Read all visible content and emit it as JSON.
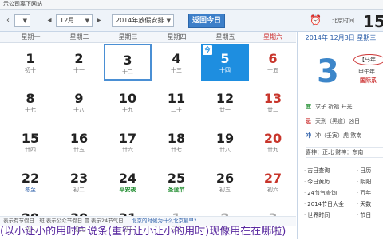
{
  "topbar": {
    "crumb": "示公司离下网站"
  },
  "toolbar": {
    "month": "12月",
    "holiday": "2014年放假安排",
    "today_button": "返回今日",
    "timezone": "北京时间",
    "time": "15:"
  },
  "weekdays": [
    "星期一",
    "星期二",
    "星期三",
    "星期四",
    "星期五",
    "星期六"
  ],
  "weeks": [
    [
      {
        "n": "1",
        "l": "初十"
      },
      {
        "n": "2",
        "l": "十一"
      },
      {
        "n": "3",
        "l": "十二",
        "state": "selected"
      },
      {
        "n": "4",
        "l": "十三"
      },
      {
        "n": "5",
        "l": "十四",
        "state": "today"
      },
      {
        "n": "6",
        "l": "十五",
        "wk": true
      }
    ],
    [
      {
        "n": "8",
        "l": "十七"
      },
      {
        "n": "9",
        "l": "十八"
      },
      {
        "n": "10",
        "l": "十九"
      },
      {
        "n": "11",
        "l": "二十"
      },
      {
        "n": "12",
        "l": "廿一"
      },
      {
        "n": "13",
        "l": "廿二",
        "wk": true
      }
    ],
    [
      {
        "n": "15",
        "l": "廿四"
      },
      {
        "n": "16",
        "l": "廿五"
      },
      {
        "n": "17",
        "l": "廿六"
      },
      {
        "n": "18",
        "l": "廿七"
      },
      {
        "n": "19",
        "l": "廿八"
      },
      {
        "n": "20",
        "l": "廿九",
        "wk": true
      }
    ],
    [
      {
        "n": "22",
        "l": "冬至",
        "lc": "bl"
      },
      {
        "n": "23",
        "l": "初二"
      },
      {
        "n": "24",
        "l": "平安夜",
        "lc": "g"
      },
      {
        "n": "25",
        "l": "圣诞节",
        "lc": "g"
      },
      {
        "n": "26",
        "l": "初五"
      },
      {
        "n": "27",
        "l": "初六",
        "wk": true
      }
    ],
    [
      {
        "n": "29",
        "l": "初八"
      },
      {
        "n": "30",
        "l": "初九"
      },
      {
        "n": "31",
        "l": "初十"
      },
      {
        "n": "1",
        "l": "元旦",
        "dim": true,
        "lc": "r"
      },
      {
        "n": "2",
        "l": "十二",
        "dim": true
      },
      {
        "n": "3",
        "l": "十三",
        "dim": true,
        "wk": true
      }
    ]
  ],
  "strip": {
    "left": "表示有节假日",
    "legend": "班   表示公众节假日   冒   表示24节气日",
    "link": "北京的时候为什么北京最早?"
  },
  "bottom_caption": "(以小让小的用时户说条(重行让小让小的用时)现像用在在哪啦)",
  "panel": {
    "date": "2014年 12月3日 星期三",
    "big_day": "3",
    "lunar_oval": "【马年",
    "lunar_year": "甲午年",
    "lunar_festival": "国际系",
    "yiji": [
      {
        "k": "宜",
        "kc": "g",
        "v": "求子  祈福  开光"
      },
      {
        "k": "忌",
        "kc": "r",
        "v": "天刑（黑道）凶日"
      },
      {
        "k": "冲",
        "kc": "b",
        "v": "冲（壬寅）虎  煞南"
      }
    ],
    "row2": "喜神：正北      财神：东南",
    "links": [
      {
        "label": "吉日查询",
        "col": 0,
        "row": 0
      },
      {
        "label": "今日黄历",
        "col": 0,
        "row": 1
      },
      {
        "label": "24节气查询",
        "col": 0,
        "row": 2
      },
      {
        "label": "2014节日大全",
        "col": 0,
        "row": 3
      },
      {
        "label": "世界时间",
        "col": 0,
        "row": 4
      },
      {
        "label": "日历",
        "col": 1,
        "row": 0
      },
      {
        "label": "阴阳",
        "col": 1,
        "row": 1
      },
      {
        "label": "万年",
        "col": 1,
        "row": 2
      },
      {
        "label": "天数",
        "col": 1,
        "row": 3
      },
      {
        "label": "节日",
        "col": 1,
        "row": 4
      }
    ]
  }
}
